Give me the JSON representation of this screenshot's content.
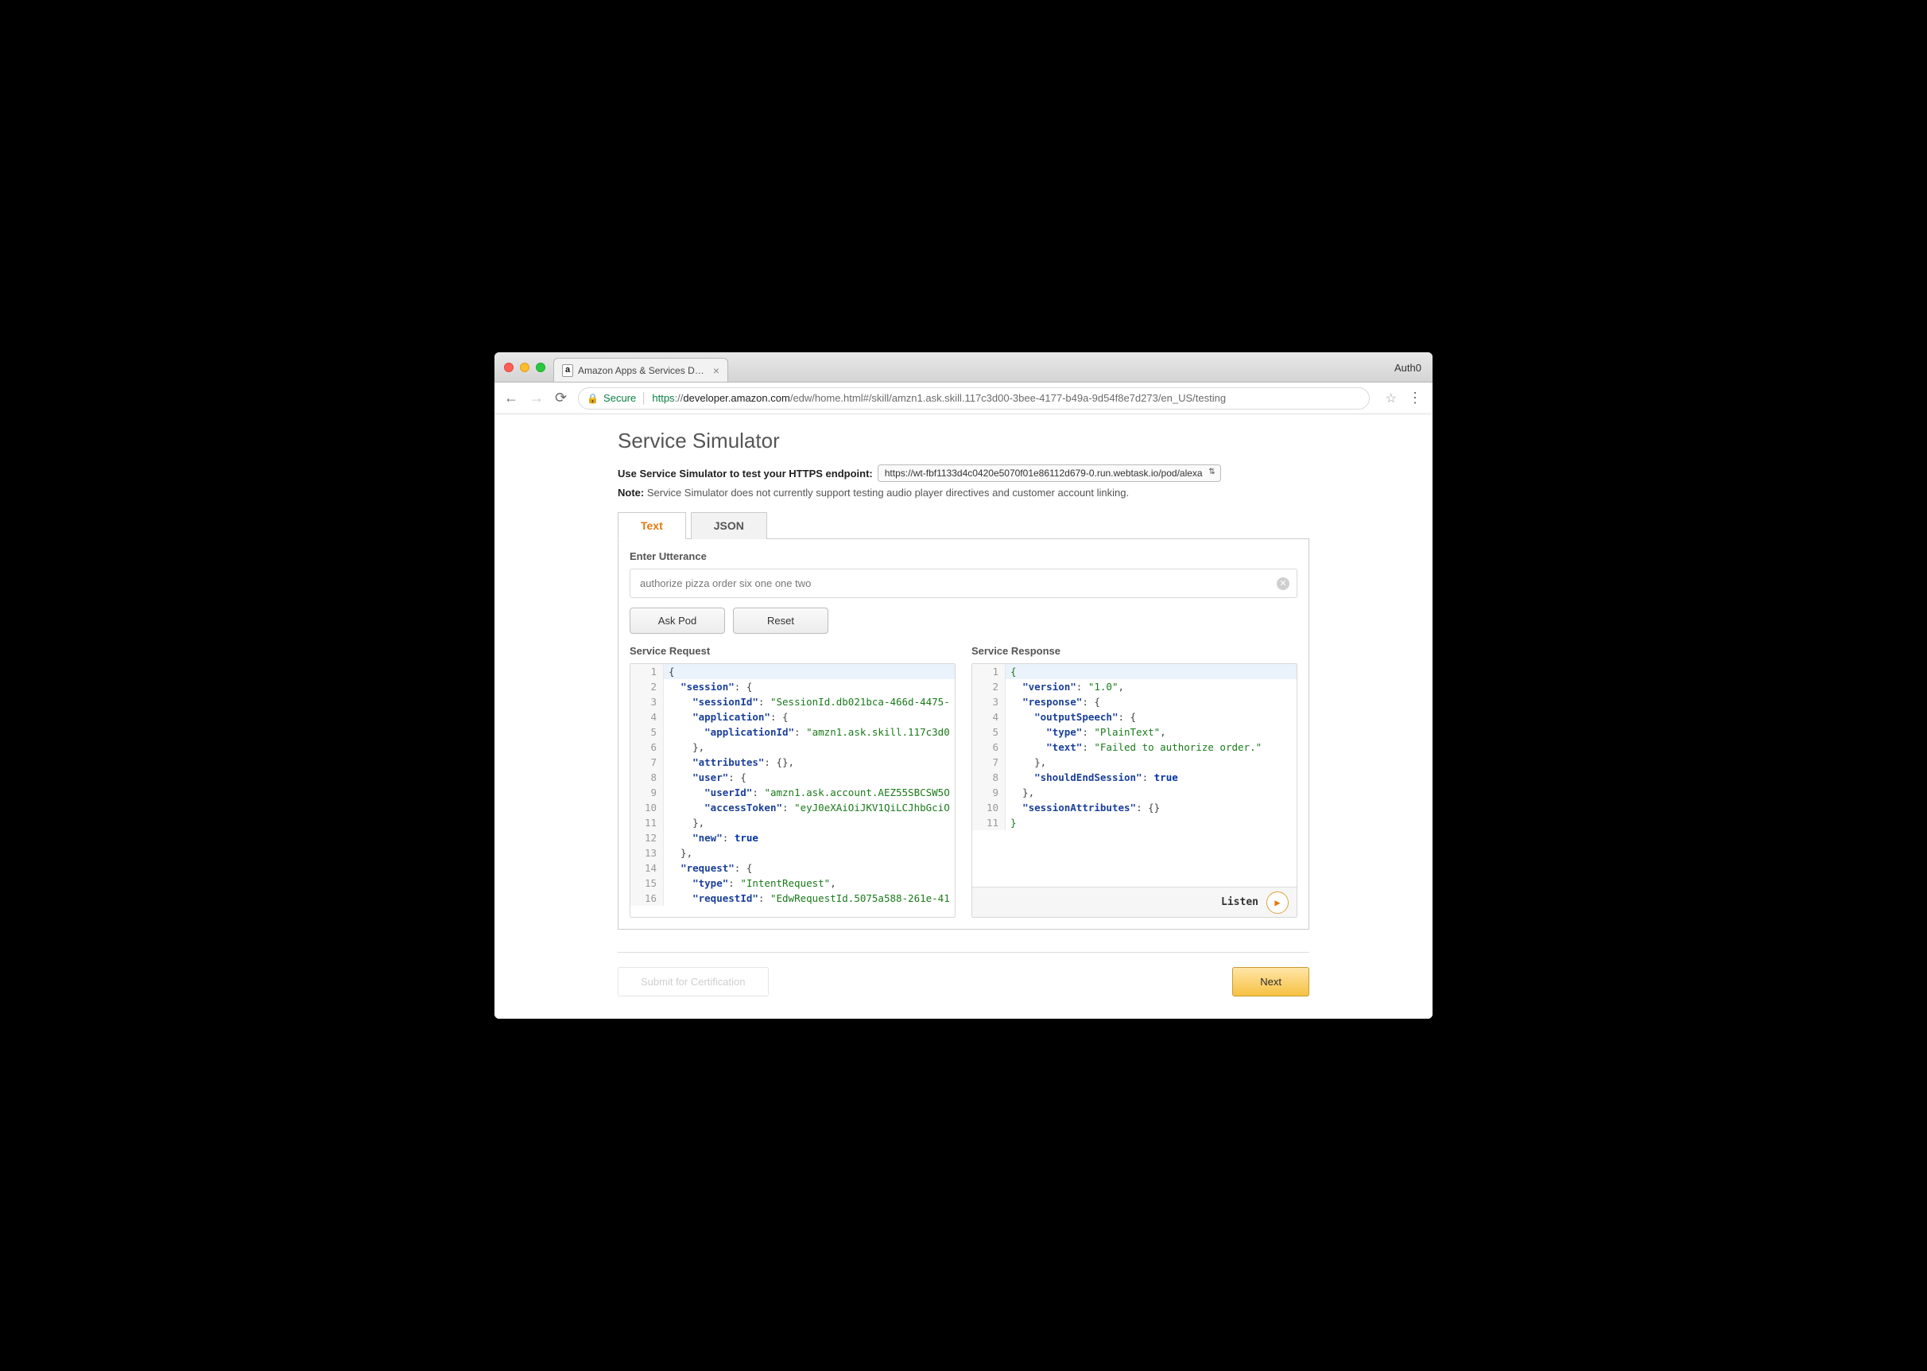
{
  "browser": {
    "tab_title": "Amazon Apps & Services Deve",
    "profile": "Auth0",
    "secure_label": "Secure",
    "url_scheme": "https",
    "url_host": "developer.amazon.com",
    "url_path": "/edw/home.html#/skill/amzn1.ask.skill.117c3d00-3bee-4177-b49a-9d54f8e7d273/en_US/testing"
  },
  "page": {
    "title": "Service Simulator",
    "intro_label": "Use Service Simulator to test your HTTPS endpoint:",
    "endpoint": "https://wt-fbf1133d4c0420e5070f01e86112d679-0.run.webtask.io/pod/alexa",
    "note_label": "Note:",
    "note_text": "Service Simulator does not currently support testing audio player directives and customer account linking.",
    "tabs": {
      "text": "Text",
      "json": "JSON"
    },
    "utterance_label": "Enter Utterance",
    "utterance_value": "authorize pizza order six one one two",
    "ask_button": "Ask Pod",
    "reset_button": "Reset",
    "request_title": "Service Request",
    "response_title": "Service Response",
    "listen_label": "Listen",
    "submit_label": "Submit for Certification",
    "next_label": "Next"
  },
  "request_lines": [
    [
      {
        "t": "{",
        "c": "punc"
      }
    ],
    [
      {
        "t": "  ",
        "c": "punc"
      },
      {
        "t": "\"session\"",
        "c": "key"
      },
      {
        "t": ": {",
        "c": "punc"
      }
    ],
    [
      {
        "t": "    ",
        "c": "punc"
      },
      {
        "t": "\"sessionId\"",
        "c": "key"
      },
      {
        "t": ": ",
        "c": "punc"
      },
      {
        "t": "\"SessionId.db021bca-466d-4475-",
        "c": "str"
      }
    ],
    [
      {
        "t": "    ",
        "c": "punc"
      },
      {
        "t": "\"application\"",
        "c": "key"
      },
      {
        "t": ": {",
        "c": "punc"
      }
    ],
    [
      {
        "t": "      ",
        "c": "punc"
      },
      {
        "t": "\"applicationId\"",
        "c": "key"
      },
      {
        "t": ": ",
        "c": "punc"
      },
      {
        "t": "\"amzn1.ask.skill.117c3d0",
        "c": "str"
      }
    ],
    [
      {
        "t": "    },",
        "c": "punc"
      }
    ],
    [
      {
        "t": "    ",
        "c": "punc"
      },
      {
        "t": "\"attributes\"",
        "c": "key"
      },
      {
        "t": ": {},",
        "c": "punc"
      }
    ],
    [
      {
        "t": "    ",
        "c": "punc"
      },
      {
        "t": "\"user\"",
        "c": "key"
      },
      {
        "t": ": {",
        "c": "punc"
      }
    ],
    [
      {
        "t": "      ",
        "c": "punc"
      },
      {
        "t": "\"userId\"",
        "c": "key"
      },
      {
        "t": ": ",
        "c": "punc"
      },
      {
        "t": "\"amzn1.ask.account.AEZ55SBCSW5O",
        "c": "str"
      }
    ],
    [
      {
        "t": "      ",
        "c": "punc"
      },
      {
        "t": "\"accessToken\"",
        "c": "key"
      },
      {
        "t": ": ",
        "c": "punc"
      },
      {
        "t": "\"eyJ0eXAiOiJKV1QiLCJhbGciO",
        "c": "str"
      }
    ],
    [
      {
        "t": "    },",
        "c": "punc"
      }
    ],
    [
      {
        "t": "    ",
        "c": "punc"
      },
      {
        "t": "\"new\"",
        "c": "key"
      },
      {
        "t": ": ",
        "c": "punc"
      },
      {
        "t": "true",
        "c": "kw"
      }
    ],
    [
      {
        "t": "  },",
        "c": "punc"
      }
    ],
    [
      {
        "t": "  ",
        "c": "punc"
      },
      {
        "t": "\"request\"",
        "c": "key"
      },
      {
        "t": ": {",
        "c": "punc"
      }
    ],
    [
      {
        "t": "    ",
        "c": "punc"
      },
      {
        "t": "\"type\"",
        "c": "key"
      },
      {
        "t": ": ",
        "c": "punc"
      },
      {
        "t": "\"IntentRequest\"",
        "c": "str"
      },
      {
        "t": ",",
        "c": "punc"
      }
    ],
    [
      {
        "t": "    ",
        "c": "punc"
      },
      {
        "t": "\"requestId\"",
        "c": "key"
      },
      {
        "t": ": ",
        "c": "punc"
      },
      {
        "t": "\"EdwRequestId.5075a588-261e-41",
        "c": "str"
      }
    ]
  ],
  "response_lines": [
    [
      {
        "t": "{",
        "c": "brg"
      }
    ],
    [
      {
        "t": "  ",
        "c": "punc"
      },
      {
        "t": "\"version\"",
        "c": "key"
      },
      {
        "t": ": ",
        "c": "punc"
      },
      {
        "t": "\"1.0\"",
        "c": "str"
      },
      {
        "t": ",",
        "c": "punc"
      }
    ],
    [
      {
        "t": "  ",
        "c": "punc"
      },
      {
        "t": "\"response\"",
        "c": "key"
      },
      {
        "t": ": {",
        "c": "punc"
      }
    ],
    [
      {
        "t": "    ",
        "c": "punc"
      },
      {
        "t": "\"outputSpeech\"",
        "c": "key"
      },
      {
        "t": ": {",
        "c": "punc"
      }
    ],
    [
      {
        "t": "      ",
        "c": "punc"
      },
      {
        "t": "\"type\"",
        "c": "key"
      },
      {
        "t": ": ",
        "c": "punc"
      },
      {
        "t": "\"PlainText\"",
        "c": "str"
      },
      {
        "t": ",",
        "c": "punc"
      }
    ],
    [
      {
        "t": "      ",
        "c": "punc"
      },
      {
        "t": "\"text\"",
        "c": "key"
      },
      {
        "t": ": ",
        "c": "punc"
      },
      {
        "t": "\"Failed to authorize order.\"",
        "c": "str"
      }
    ],
    [
      {
        "t": "    },",
        "c": "punc"
      }
    ],
    [
      {
        "t": "    ",
        "c": "punc"
      },
      {
        "t": "\"shouldEndSession\"",
        "c": "key"
      },
      {
        "t": ": ",
        "c": "punc"
      },
      {
        "t": "true",
        "c": "kw"
      }
    ],
    [
      {
        "t": "  },",
        "c": "punc"
      }
    ],
    [
      {
        "t": "  ",
        "c": "punc"
      },
      {
        "t": "\"sessionAttributes\"",
        "c": "key"
      },
      {
        "t": ": {}",
        "c": "punc"
      }
    ],
    [
      {
        "t": "}",
        "c": "brg"
      }
    ]
  ]
}
